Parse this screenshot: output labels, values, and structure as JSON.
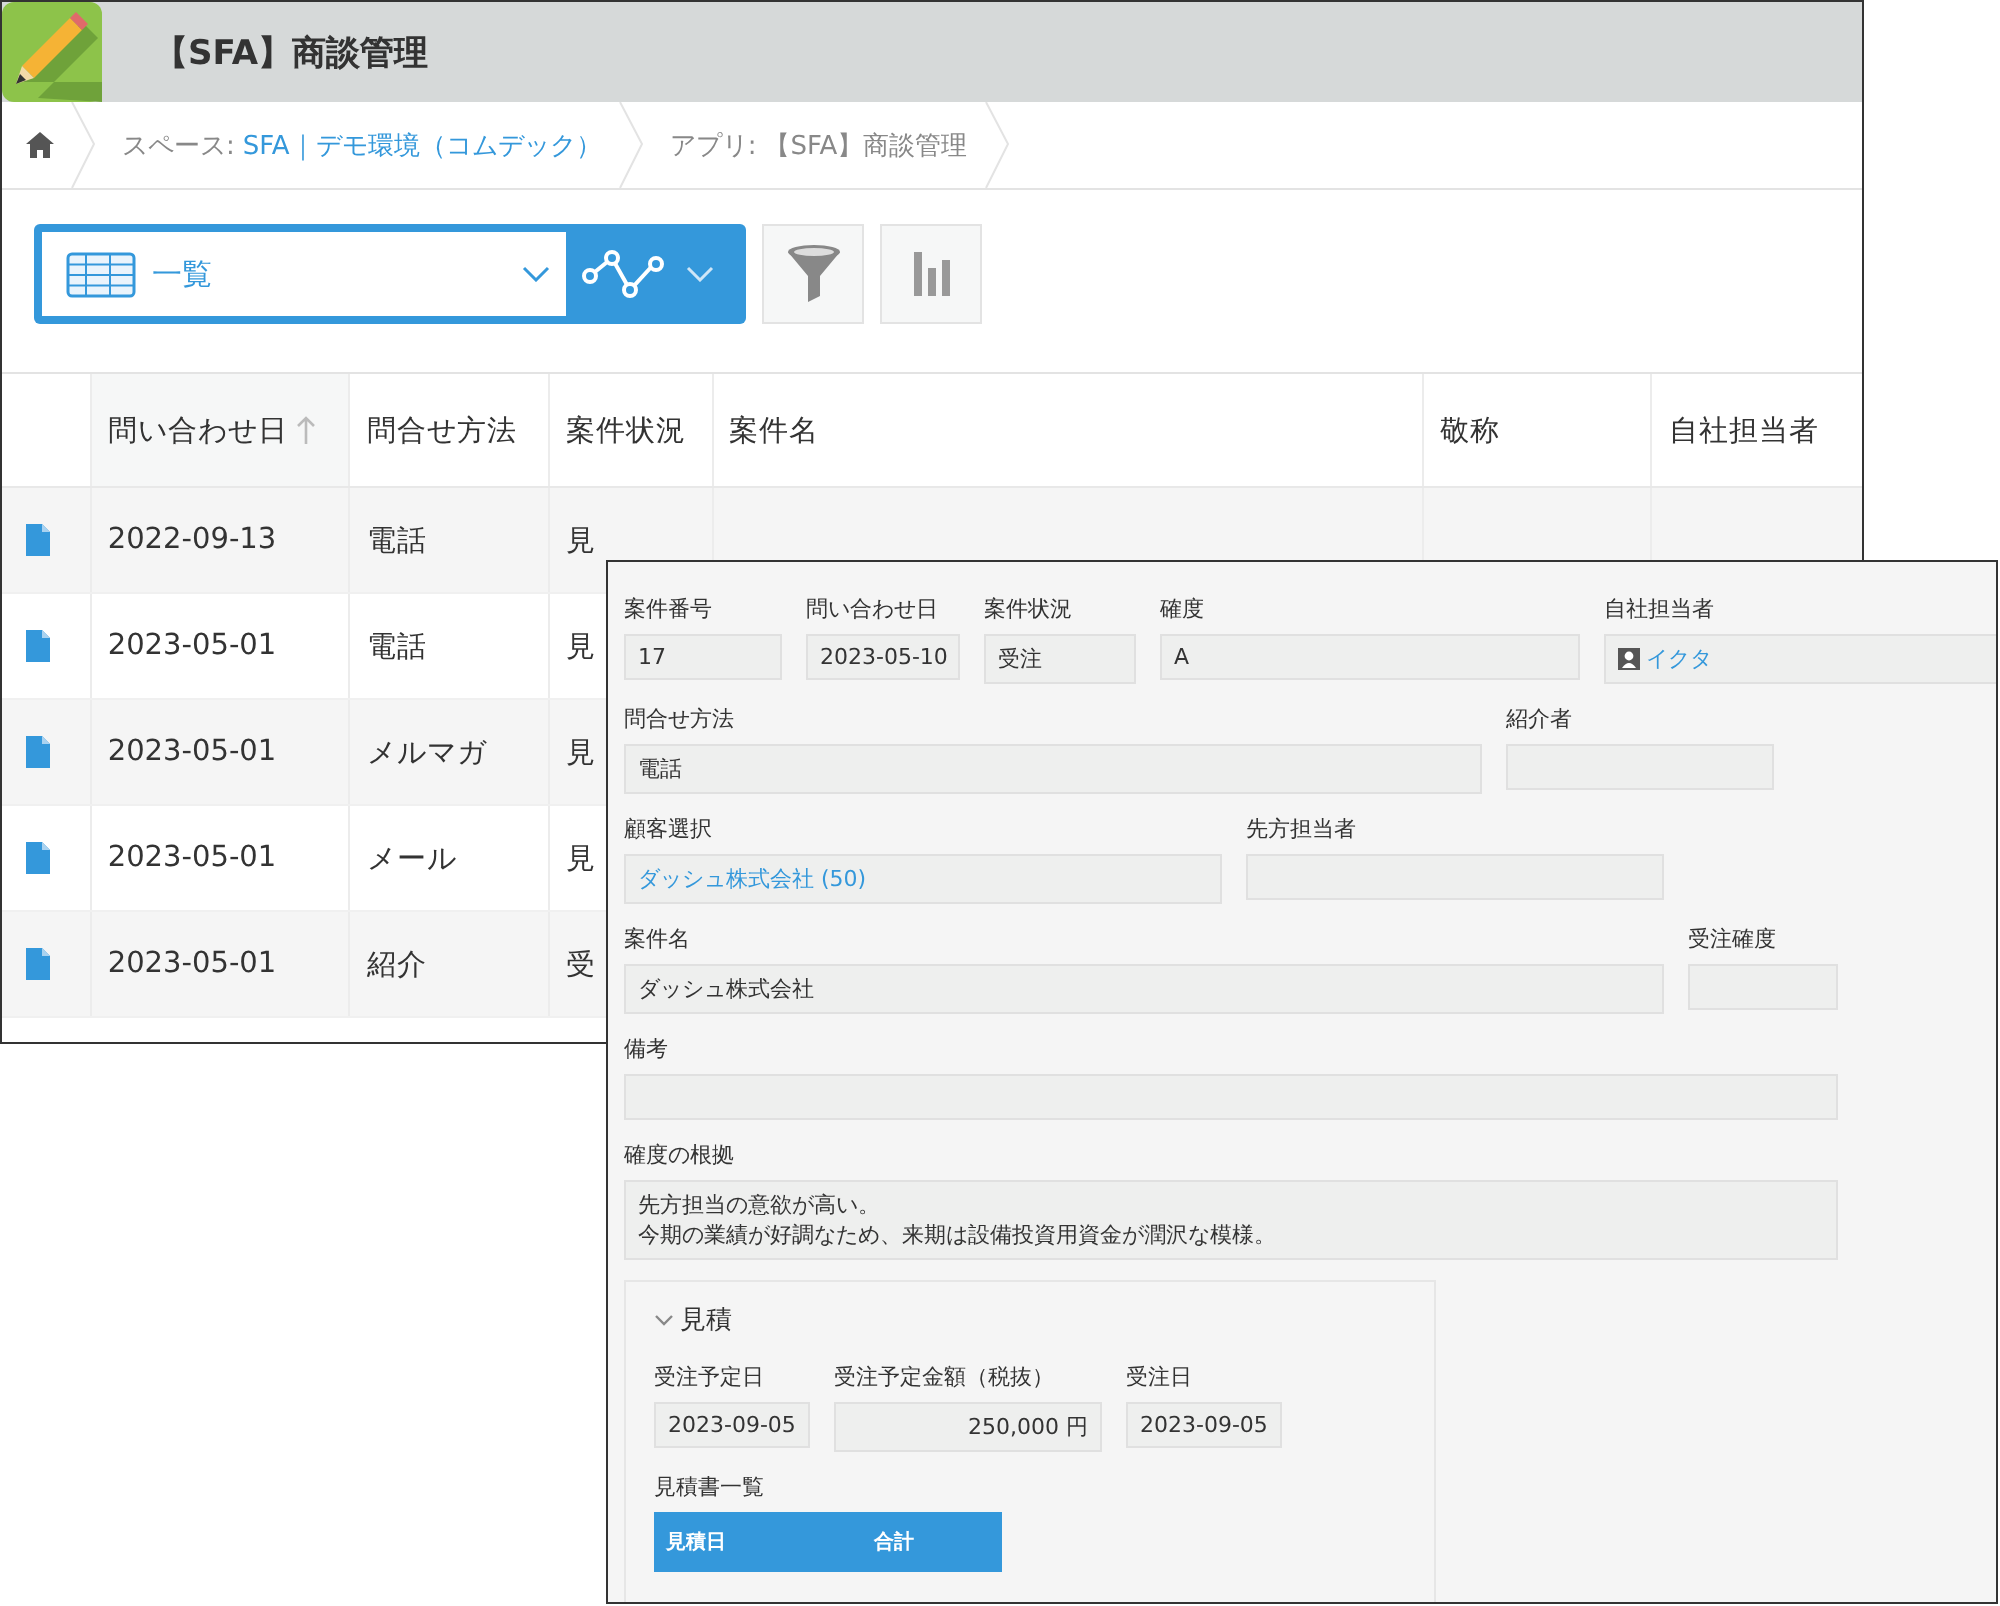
{
  "list_window": {
    "title": "【SFA】商談管理",
    "breadcrumbs": [
      {
        "kind": "home"
      },
      {
        "kind": "space",
        "label": "スペース:",
        "link": "SFA｜デモ環境（コムデック）"
      },
      {
        "kind": "app",
        "label": "アプリ:",
        "text": "【SFA】商談管理"
      }
    ],
    "view_select": {
      "value": "一覧"
    },
    "table": {
      "columns": [
        {
          "label": "問い合わせ日",
          "sorted": true
        },
        {
          "label": "問合せ方法",
          "sorted": false
        },
        {
          "label": "案件状況",
          "sorted": false
        },
        {
          "label": "案件名",
          "sorted": false
        },
        {
          "label": "敬称",
          "sorted": false
        },
        {
          "label": "自社担当者",
          "sorted": false
        }
      ],
      "rows": [
        [
          "2022-09-13",
          "電話",
          "見"
        ],
        [
          "2023-05-01",
          "電話",
          "見"
        ],
        [
          "2023-05-01",
          "メルマガ",
          "見"
        ],
        [
          "2023-05-01",
          "メール",
          "見"
        ],
        [
          "2023-05-01",
          "紹介",
          "受"
        ]
      ]
    }
  },
  "detail_window": {
    "rows": [
      [
        {
          "label": "案件番号",
          "value": "17",
          "kind": "text"
        },
        {
          "label": "問い合わせ日",
          "value": "2023-05-10",
          "kind": "text"
        },
        {
          "label": "案件状況",
          "value": "受注",
          "kind": "text"
        },
        {
          "label": "確度",
          "value": "A",
          "kind": "text"
        },
        {
          "label": "自社担当者",
          "value": "イクタ",
          "kind": "user"
        }
      ],
      [
        {
          "label": "問合せ方法",
          "value": "電話",
          "kind": "text"
        },
        {
          "label": "紹介者",
          "kind": "text"
        }
      ],
      [
        {
          "label": "顧客選択",
          "value": "ダッシュ株式会社 (50)",
          "kind": "link"
        },
        {
          "label": "先方担当者",
          "kind": "text"
        }
      ],
      [
        {
          "label": "案件名",
          "value": "ダッシュ株式会社",
          "kind": "text"
        },
        {
          "label": "受注確度",
          "kind": "text"
        }
      ],
      [
        {
          "label": "備考",
          "kind": "text"
        }
      ],
      [
        {
          "label": "確度の根拠",
          "lines": [
            "先方担当の意欲が高い。",
            "今期の業績が好調なため、来期は設備投資用資金が潤沢な模様。"
          ],
          "kind": "multiline"
        }
      ]
    ],
    "group": {
      "title": "見積",
      "expanded": true,
      "fields": [
        {
          "label": "受注予定日",
          "value": "2023-09-05",
          "kind": "text"
        },
        {
          "label": "受注予定金額（税抜）",
          "value": "250,000 円",
          "kind": "number"
        },
        {
          "label": "受注日",
          "value": "2023-09-05",
          "kind": "text"
        }
      ],
      "subtable": {
        "label": "見積書一覧",
        "columns": [
          "見積日",
          "合計"
        ]
      }
    }
  }
}
